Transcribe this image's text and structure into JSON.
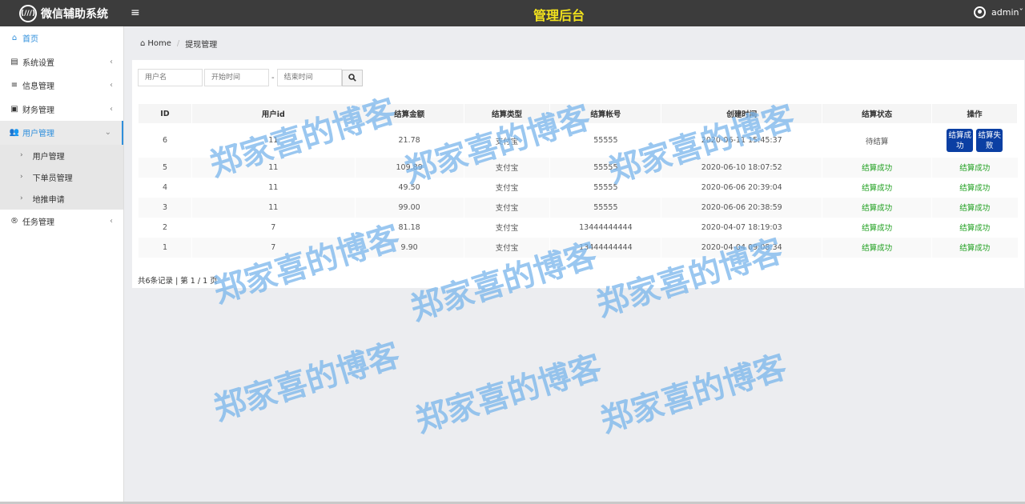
{
  "app": {
    "brand_logo": "(///)",
    "brand_name": "微信辅助系统",
    "menu_icon": "≡",
    "header_title": "管理后台",
    "user_name": "admin",
    "user_caret": "ˇ"
  },
  "sidebar": {
    "items": [
      {
        "label": "首页",
        "icon": "home-icon"
      },
      {
        "label": "系统设置",
        "icon": "server-icon"
      },
      {
        "label": "信息管理",
        "icon": "list-icon"
      },
      {
        "label": "财务管理",
        "icon": "money-icon"
      },
      {
        "label": "用户管理",
        "icon": "users-icon"
      },
      {
        "label": "任务管理",
        "icon": "registered-icon"
      }
    ],
    "sub_items": [
      "用户管理",
      "下单员管理",
      "地推申请"
    ]
  },
  "breadcrumb": {
    "home": "Home",
    "current": "提现管理"
  },
  "search": {
    "username_placeholder": "用户名",
    "start_placeholder": "开始时间",
    "dash": "-",
    "end_placeholder": "结束时间"
  },
  "table": {
    "headers": [
      "ID",
      "用户id",
      "结算金额",
      "结算类型",
      "结算帐号",
      "创建时间",
      "结算状态",
      "操作"
    ],
    "rows": [
      {
        "id": "6",
        "user_id": "11",
        "amount": "21.78",
        "type": "支付宝",
        "account": "55555",
        "created": "2020-06-11 15:45:37",
        "status": "待结算",
        "op_ok": "结算成功",
        "op_fail": "结算失败"
      },
      {
        "id": "5",
        "user_id": "11",
        "amount": "109.89",
        "type": "支付宝",
        "account": "55555",
        "created": "2020-06-10 18:07:52",
        "status": "结算成功",
        "op": "结算成功"
      },
      {
        "id": "4",
        "user_id": "11",
        "amount": "49.50",
        "type": "支付宝",
        "account": "55555",
        "created": "2020-06-06 20:39:04",
        "status": "结算成功",
        "op": "结算成功"
      },
      {
        "id": "3",
        "user_id": "11",
        "amount": "99.00",
        "type": "支付宝",
        "account": "55555",
        "created": "2020-06-06 20:38:59",
        "status": "结算成功",
        "op": "结算成功"
      },
      {
        "id": "2",
        "user_id": "7",
        "amount": "81.18",
        "type": "支付宝",
        "account": "13444444444",
        "created": "2020-04-07 18:19:03",
        "status": "结算成功",
        "op": "结算成功"
      },
      {
        "id": "1",
        "user_id": "7",
        "amount": "9.90",
        "type": "支付宝",
        "account": "13444444444",
        "created": "2020-04-04 09:08:34",
        "status": "结算成功",
        "op": "结算成功"
      }
    ]
  },
  "pager": {
    "text": "共6条记录 | 第 1 / 1 页"
  },
  "watermark": {
    "text": "郑家喜的博客"
  },
  "colors": {
    "accent": "#2f8fdc",
    "title": "#f2e21d",
    "success": "#20a020",
    "button": "#0b3fa3"
  }
}
